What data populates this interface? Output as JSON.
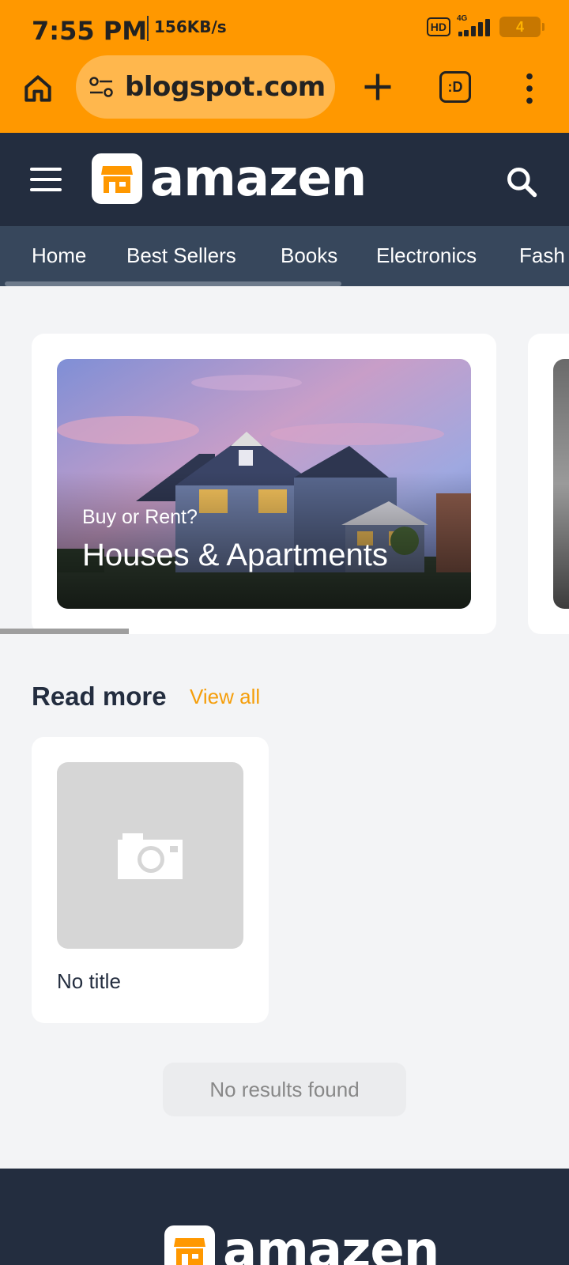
{
  "status_bar": {
    "time": "7:55 PM",
    "speed": "156KB/s",
    "hd": "HD",
    "network": "4G",
    "battery": "4"
  },
  "browser": {
    "url": "blogspot.com",
    "tabs_label": ":D"
  },
  "site": {
    "logo_text": "amazen"
  },
  "nav": {
    "items": [
      "Home",
      "Best Sellers",
      "Books",
      "Electronics",
      "Fash"
    ]
  },
  "featured": {
    "subtitle": "Buy or Rent?",
    "title": "Houses & Apartments"
  },
  "read_more": {
    "title": "Read more",
    "view_all": "View all",
    "posts": [
      {
        "title": "No title"
      }
    ]
  },
  "no_results": "No results found",
  "footer": {
    "logo_text": "amazen"
  },
  "colors": {
    "browser_bar": "#ff9800",
    "header": "#232d3f",
    "nav": "#37475c",
    "accent": "#f59e0b",
    "page_bg": "#f3f4f6"
  }
}
